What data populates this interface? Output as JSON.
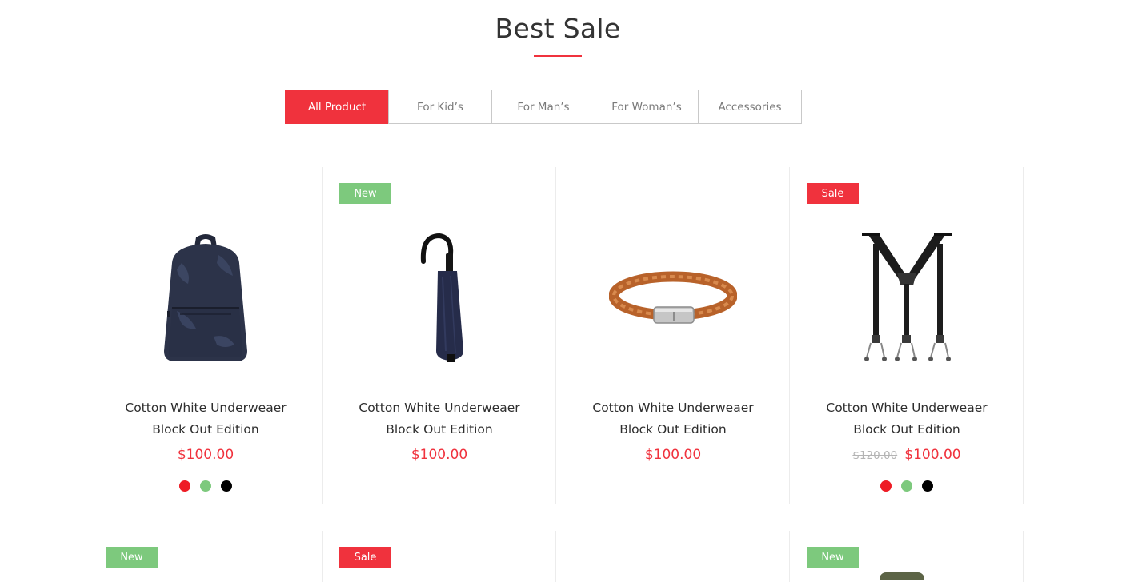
{
  "section": {
    "title": "Best Sale"
  },
  "tabs": [
    {
      "label": "All Product",
      "active": true
    },
    {
      "label": "For Kid’s",
      "active": false
    },
    {
      "label": "For Man’s",
      "active": false
    },
    {
      "label": "For Woman’s",
      "active": false
    },
    {
      "label": "Accessories",
      "active": false
    }
  ],
  "products": [
    {
      "image": "backpack-image",
      "name_line1": "Cotton White Underweaer",
      "name_line2": "Block Out Edition",
      "price": "$100.00",
      "swatches": [
        "#ee1c25",
        "#7dc97d",
        "#000000"
      ]
    },
    {
      "badge": "New",
      "image": "umbrella-image",
      "name_line1": "Cotton White Underweaer",
      "name_line2": "Block Out Edition",
      "price": "$100.00"
    },
    {
      "image": "leather-bracelet-image",
      "name_line1": "Cotton White Underweaer",
      "name_line2": "Block Out Edition",
      "price": "$100.00"
    },
    {
      "badge": "Sale",
      "image": "suspenders-image",
      "name_line1": "Cotton White Underweaer",
      "name_line2": "Block Out Edition",
      "old_price": "$120.00",
      "price": "$100.00",
      "swatches": [
        "#ee1c25",
        "#7dc97d",
        "#000000"
      ]
    }
  ],
  "row2_badges": [
    "New",
    "Sale",
    "",
    "New"
  ],
  "colors": {
    "accent": "#f0323d",
    "new_badge": "#7dc97d"
  }
}
